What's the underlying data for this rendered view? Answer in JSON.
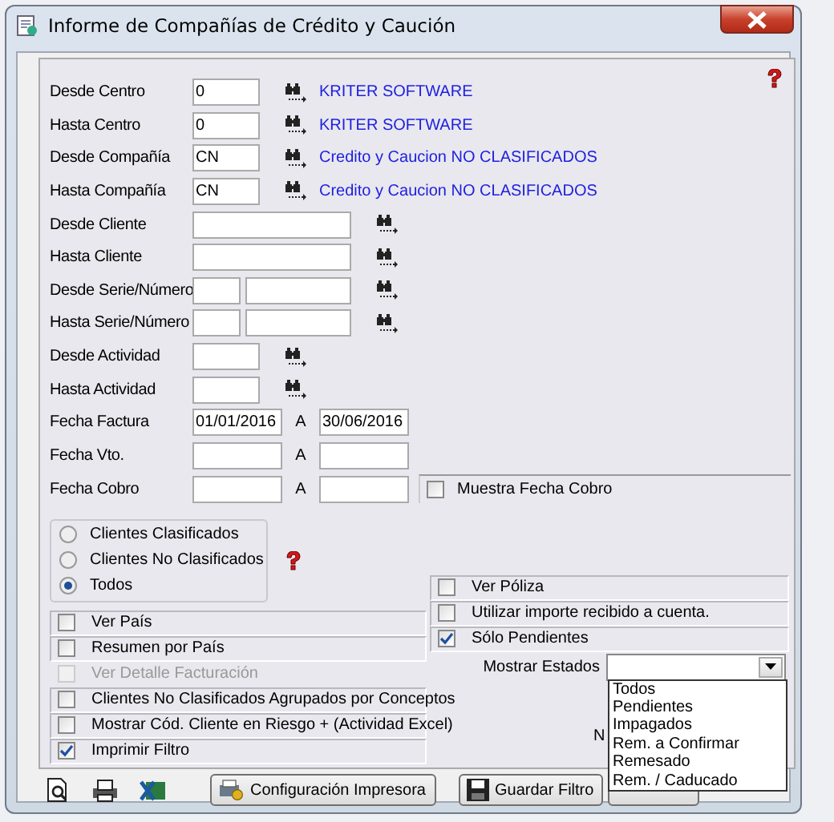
{
  "window": {
    "title": "Informe de Compañías de Crédito y Caución"
  },
  "fields": [
    {
      "kind": "lookup",
      "label": "Desde Centro",
      "value": "0",
      "link": "KRITER SOFTWARE"
    },
    {
      "kind": "lookup",
      "label": "Hasta Centro",
      "value": "0",
      "link": "KRITER SOFTWARE"
    },
    {
      "kind": "lookup",
      "label": "Desde Compañía",
      "value": "CN",
      "link": "Credito y Caucion NO CLASIFICADOS"
    },
    {
      "kind": "lookup",
      "label": "Hasta Compañía",
      "value": "CN",
      "link": "Credito y Caucion NO CLASIFICADOS"
    },
    {
      "kind": "wide",
      "label": "Desde Cliente"
    },
    {
      "kind": "wide",
      "label": "Hasta Cliente"
    },
    {
      "kind": "pair",
      "label": "Desde Serie/Número"
    },
    {
      "kind": "pair",
      "label": "Hasta Serie/Número"
    },
    {
      "kind": "lookup",
      "label": "Desde Actividad"
    },
    {
      "kind": "lookup",
      "label": "Hasta Actividad"
    },
    {
      "kind": "range",
      "label": "Fecha Factura",
      "from": "01/01/2016",
      "separator": "A",
      "to": "30/06/2016"
    },
    {
      "kind": "range",
      "label": "Fecha Vto.",
      "separator": "A"
    },
    {
      "kind": "range",
      "label": "Fecha Cobro",
      "separator": "A",
      "side_option": {
        "label": "Muestra Fecha Cobro",
        "checked": false
      }
    }
  ],
  "radios": [
    {
      "label": "Clientes Clasificados",
      "selected": false
    },
    {
      "label": "Clientes No Clasificados",
      "selected": false
    },
    {
      "label": "Todos",
      "selected": true
    }
  ],
  "left_options": [
    {
      "label": "Ver País",
      "checked": false,
      "disabled": false
    },
    {
      "label": "Resumen por País",
      "checked": false,
      "disabled": false
    },
    {
      "label": "Ver Detalle Facturación",
      "checked": false,
      "disabled": true
    },
    {
      "label": "Clientes No Clasificados Agrupados por Conceptos",
      "checked": false,
      "disabled": false
    },
    {
      "label": "Mostrar Cód. Cliente en Riesgo  + (Actividad Excel)",
      "checked": false,
      "disabled": false
    },
    {
      "label": "Imprimir Filtro",
      "checked": true,
      "disabled": false
    }
  ],
  "right_options": [
    {
      "label": "Ver Póliza",
      "checked": false
    },
    {
      "label": "Utilizar importe recibido a cuenta.",
      "checked": false
    },
    {
      "label": "Sólo Pendientes",
      "checked": true
    }
  ],
  "estados": {
    "label": "Mostrar Estados",
    "expanded": true,
    "options": [
      "Todos",
      "Pendientes",
      "Impagados",
      "Rem. a Confirmar",
      "Remesado",
      "Rem. / Caducado"
    ],
    "hidden_label": "N"
  },
  "buttons": [
    {
      "kind": "config",
      "label": "Configuración Impresora"
    },
    {
      "kind": "save",
      "label": "Guardar Filtro"
    },
    {
      "kind": "covered"
    }
  ]
}
